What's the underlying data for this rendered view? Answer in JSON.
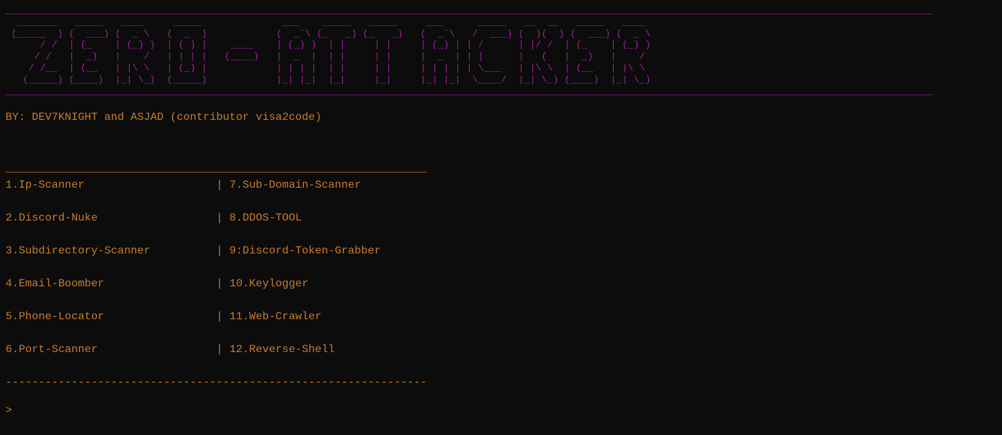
{
  "banner": {
    "top_divider": "_________________________________________________________________________________________________________________________________________________________________",
    "ascii_lines": [
      " _______  _____  ____    _____           ___    _____  _____    ___     _____  __  __  _____  ____ ",
      "(_____  )(  ___)(  _ \\  (  _  )         (  _ \\ (_   _)(_   _)  (  _ \\  / ___/ (  )(  )(  ___)(  _ \\",
      "     / / | (_   | (_) ) | ( ) |   ____  | (_) |  | |    | |    | (_) || /     | |/ / | (_   | (_) )",
      "    / /  |  _)  |    /  | | | |  (____) |  _  |  | |    | |    |  _  || |     |   <  |  _)  |    / ",
      "   / /__ | (__  | |\\ \\  | (_) |         | | | |  | |    | |    | | | || \\__   | |\\ \\ | (__  | |\\ \\ ",
      "  (_____)(____) |_| \\_) (_____)         |_| |_|  |_|    |_|    |_| |_|\\____/  |_| \\_)(____) |_| \\_)"
    ],
    "bottom_divider": "_________________________________________________________________________________________________________________________________________________________________"
  },
  "credits": "BY: DEV7KNIGHT and ASJAD (contributor visa2code)",
  "menu": {
    "divider": "________________________________________________________________",
    "rows": [
      "1.Ip-Scanner                    | 7.Sub-Domain-Scanner",
      "2.Discord-Nuke                  | 8.DDOS-TOOL",
      "3.Subdirectory-Scanner          | 9:Discord-Token-Grabber",
      "4.Email-Boomber                 | 10.Keylogger",
      "5.Phone-Locator                 | 11.Web-Crawler",
      "6.Port-Scanner                  | 12.Reverse-Shell"
    ],
    "bottom_divider": "----------------------------------------------------------------"
  },
  "prompt": ">"
}
